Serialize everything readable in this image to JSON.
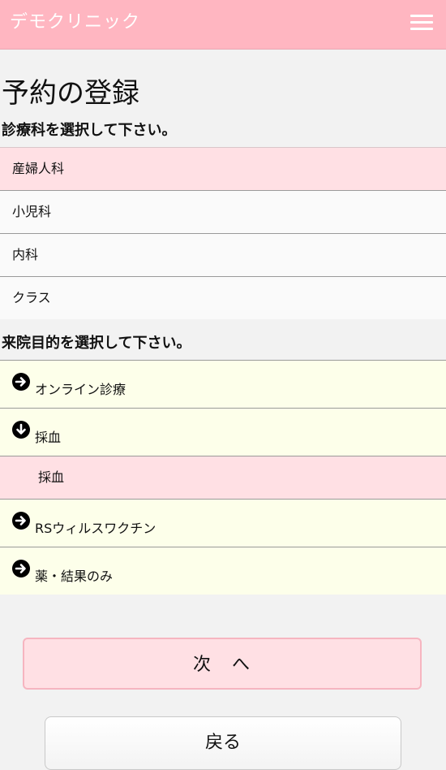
{
  "header": {
    "brand": "デモクリニック",
    "menu_icon": "hamburger-icon",
    "color": "#ffb6c1"
  },
  "page": {
    "title": "予約の登録"
  },
  "department": {
    "prompt": "診療科を選択して下さい。",
    "items": [
      {
        "label": "産婦人科",
        "selected": true
      },
      {
        "label": "小児科",
        "selected": false
      },
      {
        "label": "内科",
        "selected": false
      },
      {
        "label": "クラス",
        "selected": false
      }
    ]
  },
  "purpose": {
    "prompt": "来院目的を選択して下さい。",
    "items": [
      {
        "label": "オンライン診療",
        "icon": "arrow-right-circle-icon"
      },
      {
        "label": "採血",
        "icon": "arrow-down-circle-icon"
      },
      {
        "label": "採血",
        "sub": true
      },
      {
        "label": "RSウィルスワクチン",
        "icon": "arrow-right-circle-icon"
      },
      {
        "label": "薬・結果のみ",
        "icon": "arrow-right-circle-icon"
      }
    ]
  },
  "buttons": {
    "next": "次　へ",
    "back": "戻る"
  }
}
